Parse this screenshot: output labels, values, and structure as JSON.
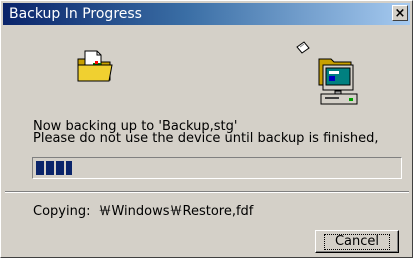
{
  "window": {
    "title": "Backup In Progress",
    "close_glyph": "×"
  },
  "message": {
    "line1": "Now backing up to 'Backup,stg'",
    "line2": "Please do not use the device until backup is finished,"
  },
  "progress": {
    "fraction": 0.1
  },
  "copy": {
    "label": "Copying:",
    "path": "￦Windows￦Restore,fdf"
  },
  "buttons": {
    "cancel": "Cancel"
  },
  "icons": {
    "source": "folder-icon",
    "flying": "paper-icon",
    "target": "computer-icon"
  },
  "colors": {
    "title_start": "#0a246a",
    "title_end": "#a6caf0",
    "face": "#d4d0c8",
    "progress_block": "#0a246a"
  }
}
